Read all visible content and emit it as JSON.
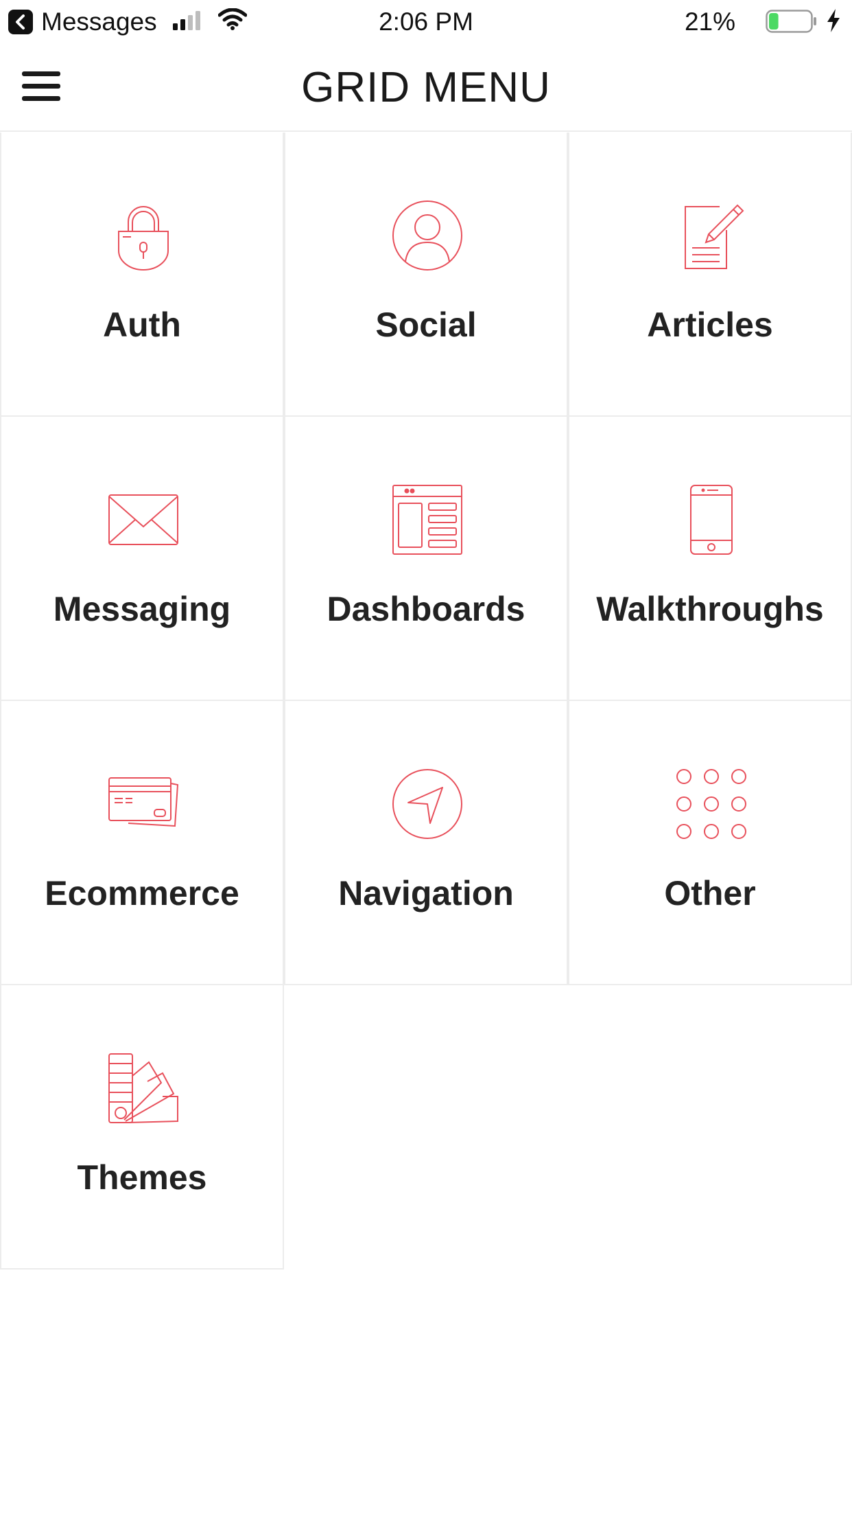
{
  "status_bar": {
    "back_app": "Messages",
    "time": "2:06 PM",
    "battery_percent": "21%",
    "battery_level": 0.21
  },
  "nav": {
    "title": "GRID MENU",
    "menu_icon": "hamburger-menu-icon"
  },
  "colors": {
    "accent": "#e8505b",
    "battery_fill": "#4cd964",
    "divider": "#ececec"
  },
  "menu": {
    "items": [
      {
        "label": "Auth",
        "icon": "lock-icon"
      },
      {
        "label": "Social",
        "icon": "user-profile-icon"
      },
      {
        "label": "Articles",
        "icon": "document-edit-icon"
      },
      {
        "label": "Messaging",
        "icon": "envelope-icon"
      },
      {
        "label": "Dashboards",
        "icon": "dashboard-window-icon"
      },
      {
        "label": "Walkthroughs",
        "icon": "smartphone-icon"
      },
      {
        "label": "Ecommerce",
        "icon": "credit-card-icon"
      },
      {
        "label": "Navigation",
        "icon": "navigation-arrow-icon"
      },
      {
        "label": "Other",
        "icon": "dots-grid-icon"
      },
      {
        "label": "Themes",
        "icon": "color-swatches-icon"
      }
    ]
  }
}
